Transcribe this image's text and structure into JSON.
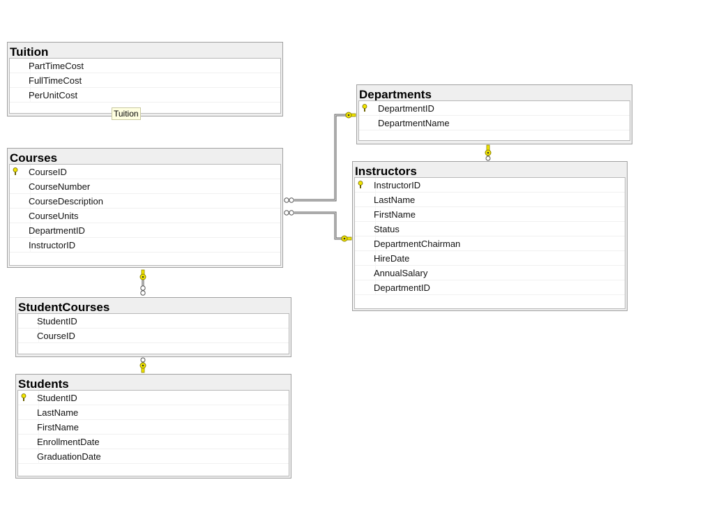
{
  "tables": {
    "tuition": {
      "title": "Tuition",
      "columns": [
        {
          "name": "PartTimeCost",
          "pk": false
        },
        {
          "name": "FullTimeCost",
          "pk": false
        },
        {
          "name": "PerUnitCost",
          "pk": false
        }
      ],
      "tag": "Tuition"
    },
    "courses": {
      "title": "Courses",
      "columns": [
        {
          "name": "CourseID",
          "pk": true
        },
        {
          "name": "CourseNumber",
          "pk": false
        },
        {
          "name": "CourseDescription",
          "pk": false
        },
        {
          "name": "CourseUnits",
          "pk": false
        },
        {
          "name": "DepartmentID",
          "pk": false
        },
        {
          "name": "InstructorID",
          "pk": false
        }
      ]
    },
    "departments": {
      "title": "Departments",
      "columns": [
        {
          "name": "DepartmentID",
          "pk": true
        },
        {
          "name": "DepartmentName",
          "pk": false
        }
      ]
    },
    "instructors": {
      "title": "Instructors",
      "columns": [
        {
          "name": "InstructorID",
          "pk": true
        },
        {
          "name": "LastName",
          "pk": false
        },
        {
          "name": "FirstName",
          "pk": false
        },
        {
          "name": "Status",
          "pk": false
        },
        {
          "name": "DepartmentChairman",
          "pk": false
        },
        {
          "name": "HireDate",
          "pk": false
        },
        {
          "name": "AnnualSalary",
          "pk": false
        },
        {
          "name": "DepartmentID",
          "pk": false
        }
      ]
    },
    "studentcourses": {
      "title": "StudentCourses",
      "columns": [
        {
          "name": "StudentID",
          "pk": false
        },
        {
          "name": "CourseID",
          "pk": false
        }
      ]
    },
    "students": {
      "title": "Students",
      "columns": [
        {
          "name": "StudentID",
          "pk": true
        },
        {
          "name": "LastName",
          "pk": false
        },
        {
          "name": "FirstName",
          "pk": false
        },
        {
          "name": "EnrollmentDate",
          "pk": false
        },
        {
          "name": "GraduationDate",
          "pk": false
        }
      ]
    }
  },
  "relationships": [
    {
      "from": "courses",
      "to": "departments",
      "one_end": "key-icon",
      "many_end": "infinity-icon"
    },
    {
      "from": "courses",
      "to": "instructors",
      "one_end": "key-icon",
      "many_end": "infinity-icon"
    },
    {
      "from": "instructors",
      "to": "departments",
      "one_end": "key-icon",
      "many_end": "infinity-icon"
    },
    {
      "from": "studentcourses",
      "to": "courses",
      "one_end": "key-icon",
      "many_end": "infinity-icon"
    },
    {
      "from": "studentcourses",
      "to": "students",
      "one_end": "key-icon",
      "many_end": "infinity-icon"
    }
  ],
  "colors": {
    "key": "#f2e600",
    "connector": "#555555",
    "title_bar": "#efefef"
  }
}
